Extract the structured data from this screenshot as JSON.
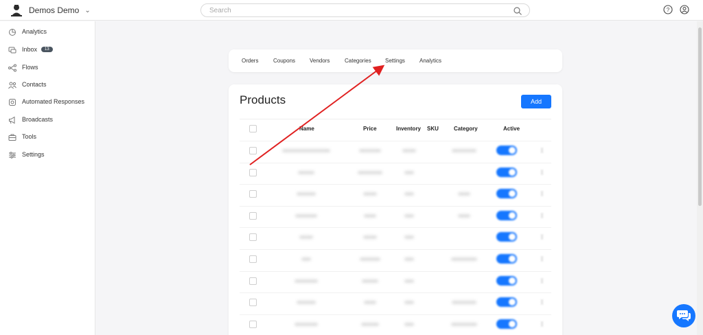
{
  "header": {
    "workspace_name": "Demos Demo",
    "search_placeholder": "Search"
  },
  "sidebar": {
    "items": [
      {
        "label": "Analytics",
        "icon": "analytics-icon"
      },
      {
        "label": "Inbox",
        "icon": "inbox-icon",
        "badge": "13"
      },
      {
        "label": "Flows",
        "icon": "flows-icon"
      },
      {
        "label": "Contacts",
        "icon": "contacts-icon"
      },
      {
        "label": "Automated Responses",
        "icon": "automated-responses-icon"
      },
      {
        "label": "Broadcasts",
        "icon": "broadcast-icon"
      },
      {
        "label": "Tools",
        "icon": "tools-icon"
      },
      {
        "label": "Settings",
        "icon": "settings-icon"
      }
    ]
  },
  "tabs": [
    "Orders",
    "Coupons",
    "Vendors",
    "Categories",
    "Settings",
    "Analytics"
  ],
  "products": {
    "title": "Products",
    "add_label": "Add",
    "columns": [
      "Name",
      "Price",
      "Inventory",
      "SKU",
      "Category",
      "Active"
    ],
    "row_count": 9,
    "rows_active": [
      true,
      true,
      true,
      true,
      true,
      true,
      true,
      true,
      true
    ]
  },
  "colors": {
    "accent": "#1677ff",
    "annotation": "#e02020"
  }
}
